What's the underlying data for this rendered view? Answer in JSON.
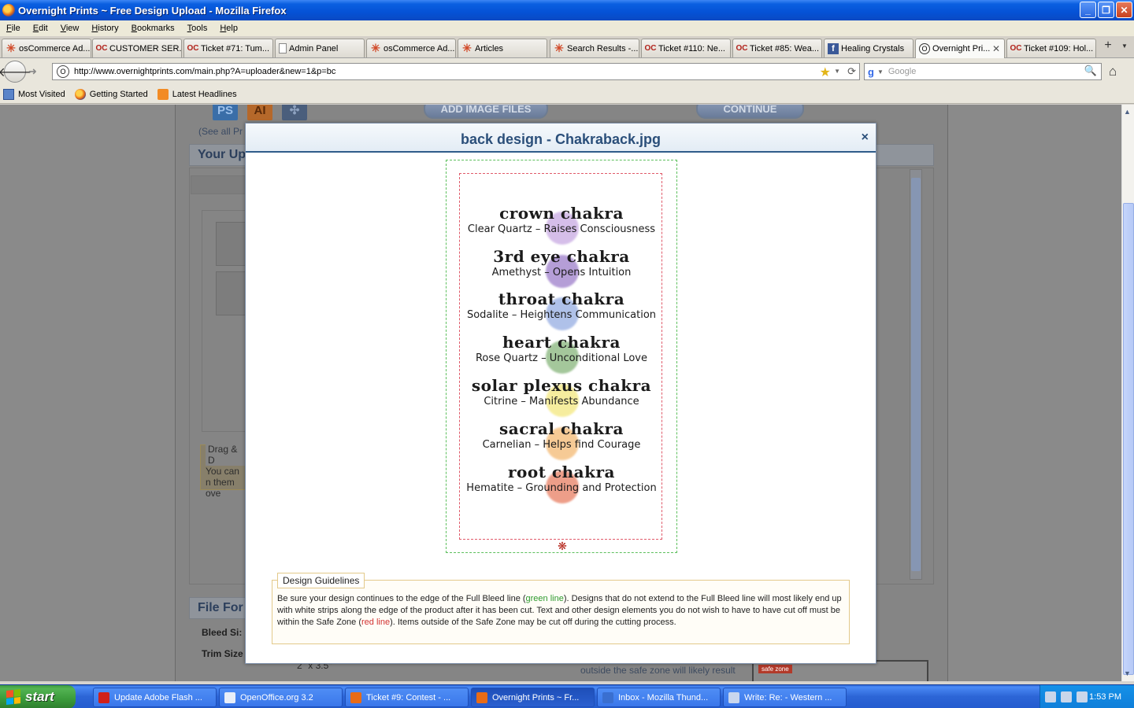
{
  "window": {
    "title": "Overnight Prints ~ Free Design Upload - Mozilla Firefox",
    "min": "_",
    "max": "❐",
    "close": "✕"
  },
  "menu": [
    "File",
    "Edit",
    "View",
    "History",
    "Bookmarks",
    "Tools",
    "Help"
  ],
  "tabs": [
    {
      "label": "osCommerce Ad...",
      "icon": "oscommerce-icon"
    },
    {
      "label": "CUSTOMER SER...",
      "icon": "oc-icon"
    },
    {
      "label": "Ticket #71: Tum...",
      "icon": "oc-icon"
    },
    {
      "label": "Admin Panel",
      "icon": "page-icon"
    },
    {
      "label": "osCommerce Ad...",
      "icon": "oscommerce-icon"
    },
    {
      "label": "Articles",
      "icon": "oscommerce-icon"
    },
    {
      "label": "Search Results -...",
      "icon": "oscommerce-icon"
    },
    {
      "label": "Ticket #110: Ne...",
      "icon": "oc-icon"
    },
    {
      "label": "Ticket #85: Wea...",
      "icon": "oc-icon"
    },
    {
      "label": "Healing Crystals",
      "icon": "facebook-icon"
    },
    {
      "label": "Overnight Pri...",
      "icon": "overnight-icon",
      "active": true
    },
    {
      "label": "Ticket #109: Hol...",
      "icon": "oc-icon"
    }
  ],
  "nav": {
    "url": "http://www.overnightprints.com/main.php?A=uploader&new=1&p=bc",
    "search_placeholder": "Google"
  },
  "bookmarks": [
    "Most Visited",
    "Getting Started",
    "Latest Headlines"
  ],
  "page": {
    "add_image_button": "ADD IMAGE FILES",
    "continue_button": "CONTINUE",
    "ps_icon": "PS",
    "ai_icon": "AI",
    "see_all": "(See all Pr",
    "your_uploads": "Your Up",
    "drag_legend": "Drag & D",
    "drag_text": "You can n them ove",
    "file_format": "File For",
    "bleed_size_label": "Bleed Si:",
    "trim_size_label": "Trim Size",
    "trim_size_value": "2\" x 3.5\"",
    "safe_zone_note": "outside the safe zone will likely result",
    "safe_zone_tag": "safe zone"
  },
  "modal": {
    "title": "back design - Chakraback.jpg",
    "close": "×",
    "chakras": [
      {
        "name": "crown chakra",
        "desc": "Clear Quartz – Raises Consciousness",
        "color": "#b48ad8"
      },
      {
        "name": "3rd eye chakra",
        "desc": "Amethyst – Opens Intuition",
        "color": "#7a4fb8"
      },
      {
        "name": "throat chakra",
        "desc": "Sodalite – Heightens Communication",
        "color": "#6f8fd8"
      },
      {
        "name": "heart chakra",
        "desc": "Rose Quartz – Unconditional Love",
        "color": "#5a9a4a"
      },
      {
        "name": "solar plexus chakra",
        "desc": "Citrine – Manifests Abundance",
        "color": "#f0e050"
      },
      {
        "name": "sacral chakra",
        "desc": "Carnelian – Helps find Courage",
        "color": "#f0a040"
      },
      {
        "name": "root chakra",
        "desc": "Hematite – Grounding and Protection",
        "color": "#e0502a"
      }
    ],
    "guidelines_label": "Design Guidelines",
    "guidelines": {
      "p1": "Be sure your design continues to the edge of the Full Bleed line (",
      "green": "green line",
      "p2": "). Designs that do not extend to the Full Bleed line will most likely end up with white strips along the edge of the product after it has been cut. Text and other design elements you do not wish to have to have cut off must be within the Safe Zone (",
      "red": "red line",
      "p3": "). Items outside of the Safe Zone may be cut off during the cutting process."
    }
  },
  "taskbar": {
    "start": "start",
    "items": [
      {
        "label": "Update Adobe Flash ...",
        "color": "#d0201a"
      },
      {
        "label": "OpenOffice.org 3.2",
        "color": "#e8eef8"
      },
      {
        "label": "Ticket #9: Contest - ...",
        "color": "#e86b16"
      },
      {
        "label": "Overnight Prints ~ Fr...",
        "color": "#e86b16",
        "active": true
      },
      {
        "label": "Inbox - Mozilla Thund...",
        "color": "#3a6fd0"
      },
      {
        "label": "Write: Re: - Western ...",
        "color": "#c8d6ee"
      }
    ],
    "clock": "1:53 PM"
  }
}
